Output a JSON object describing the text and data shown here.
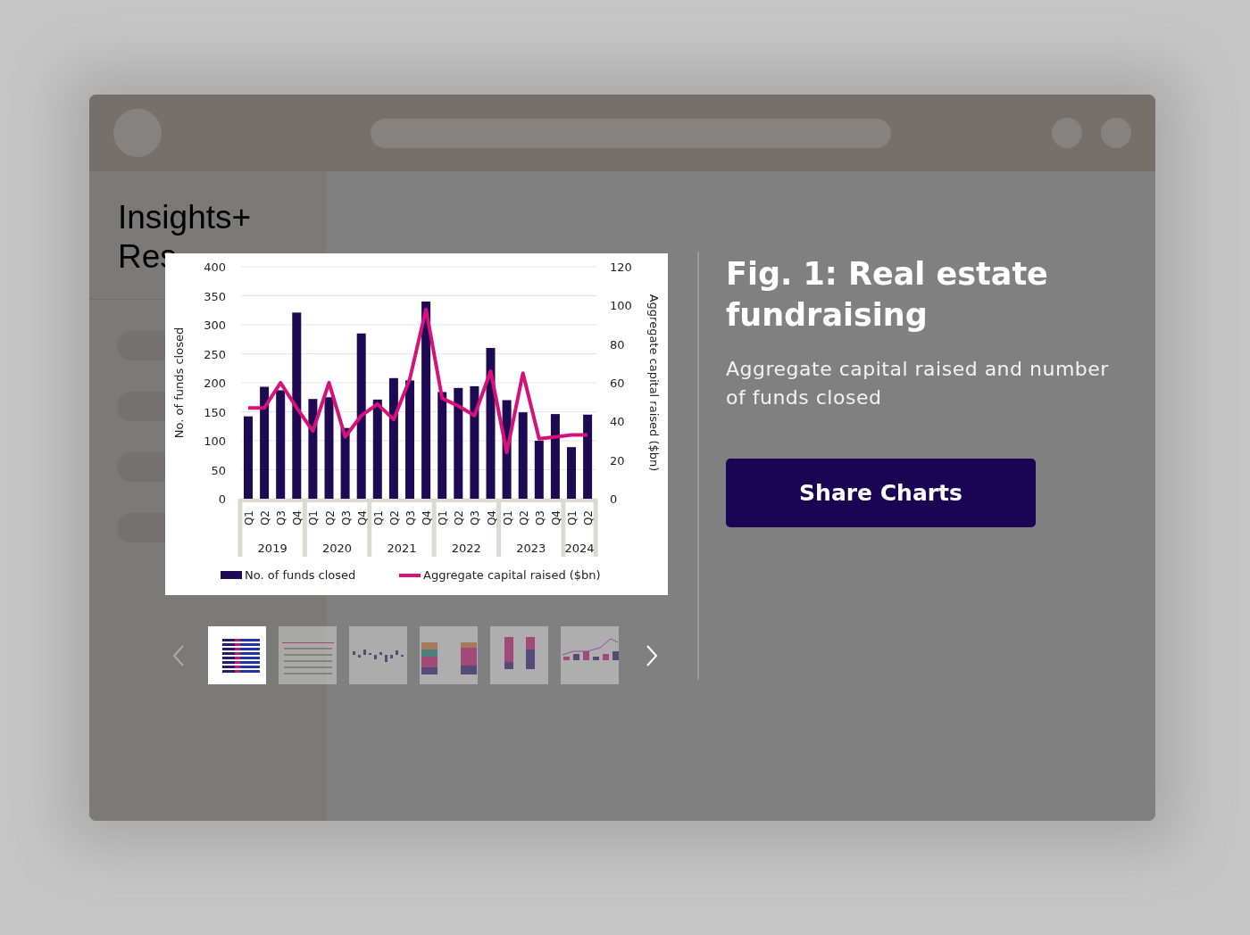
{
  "sidebar": {
    "logo_lines": [
      "Insights+",
      "Res"
    ],
    "items": [
      {
        "kind": "placeholder"
      },
      {
        "kind": "placeholder"
      },
      {
        "kind": "placeholder"
      },
      {
        "kind": "placeholder"
      }
    ]
  },
  "figure": {
    "chart_data": {
      "type": "bar",
      "categories": [
        "Q1",
        "Q2",
        "Q3",
        "Q4",
        "Q1",
        "Q2",
        "Q3",
        "Q4",
        "Q1",
        "Q2",
        "Q3",
        "Q4",
        "Q1",
        "Q2",
        "Q3",
        "Q4",
        "Q1",
        "Q2",
        "Q3",
        "Q4",
        "Q1",
        "Q2"
      ],
      "annotations": [
        "2019",
        "2020",
        "2021",
        "2022",
        "2023",
        "2024"
      ],
      "grid": true,
      "legend": "bottom",
      "ylabel": "No. of funds closed",
      "y2label": "Aggregate capital raised ($bn)",
      "ylim": [
        0,
        400
      ],
      "yticks": [
        0,
        50,
        100,
        150,
        200,
        250,
        300,
        350,
        400
      ],
      "y2lim": [
        0,
        120
      ],
      "y2ticks": [
        0,
        20,
        40,
        60,
        80,
        100,
        120
      ],
      "series": [
        {
          "name": "No. of funds closed",
          "type": "bar",
          "color": "#1e0a52",
          "values": [
            142,
            193,
            187,
            321,
            172,
            175,
            122,
            285,
            171,
            208,
            204,
            340,
            184,
            191,
            194,
            260,
            170,
            149,
            100,
            146,
            89,
            145
          ]
        },
        {
          "name": "Aggregate capital raised ($bn)",
          "type": "line",
          "axis": "y2",
          "color": "#d6117a",
          "values": [
            47,
            47,
            60,
            47,
            35,
            60,
            32,
            43,
            49,
            41,
            62,
            98,
            52,
            48,
            43,
            66,
            24,
            65,
            31,
            32,
            33,
            33
          ]
        }
      ]
    },
    "title": "Fig. 1: Real estate fundraising",
    "subtitle": "Aggregate capital raised and number of funds closed",
    "button": "Share Charts"
  },
  "thumbnails": [
    {
      "kind": "hbars",
      "selected": true
    },
    {
      "kind": "table",
      "selected": false
    },
    {
      "kind": "bars",
      "selected": false
    },
    {
      "kind": "stacked",
      "selected": false
    },
    {
      "kind": "columns",
      "selected": false
    },
    {
      "kind": "line",
      "selected": false
    }
  ]
}
